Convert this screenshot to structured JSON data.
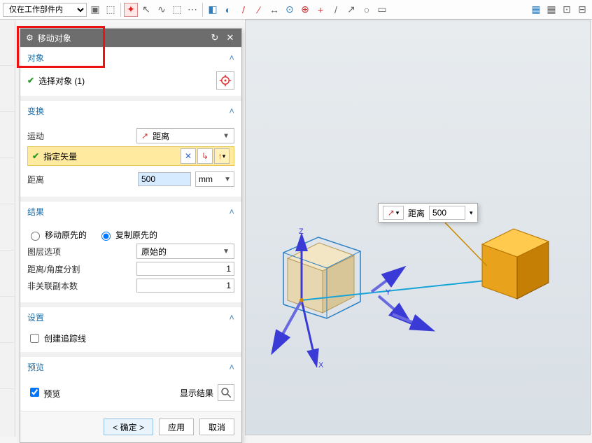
{
  "topbar": {
    "filter_dropdown": "仅在工作部件内"
  },
  "panel": {
    "title": "移动对象",
    "sections": {
      "object": "对象",
      "select_object": "选择对象 (1)",
      "transform": "变换",
      "motion_label": "运动",
      "motion_value": "距离",
      "specify_vector": "指定矢量",
      "distance_label": "距离",
      "distance_value": "500",
      "distance_unit": "mm",
      "result": "结果",
      "move_original": "移动原先的",
      "copy_original": "复制原先的",
      "layer_option_label": "图层选项",
      "layer_option_value": "原始的",
      "distance_angle_split_label": "距离/角度分割",
      "distance_angle_split_value": "1",
      "nonassoc_copies_label": "非关联副本数",
      "nonassoc_copies_value": "1",
      "settings": "设置",
      "create_trace": "创建追踪线",
      "preview_section": "预览",
      "preview_checkbox": "预览",
      "show_result": "显示结果"
    },
    "buttons": {
      "ok": "< 确定 >",
      "apply": "应用",
      "cancel": "取消"
    }
  },
  "floating": {
    "label": "距离",
    "value": "500"
  },
  "axes": {
    "x": "X",
    "y": "Y",
    "z": "Z"
  }
}
